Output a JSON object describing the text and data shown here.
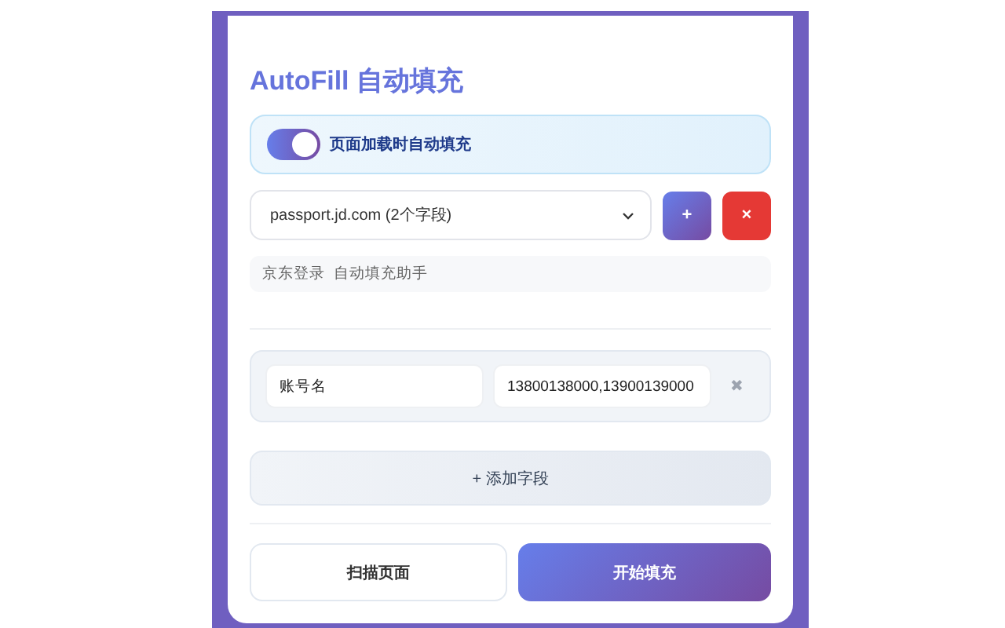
{
  "title": "AutoFill 自动填充",
  "auto_fill_toggle": {
    "label": "页面加载时自动填充",
    "on": true
  },
  "site_select": {
    "value": "passport.jd.com (2个字段)",
    "add_label": "+",
    "delete_label": "×"
  },
  "site_note": "京东登录  自动填充助手",
  "fields": [
    {
      "name": "账号名",
      "value": "13800138000,13900139000",
      "remove_label": "✖"
    }
  ],
  "add_field_label": "+ 添加字段",
  "buttons": [
    {
      "label": "扫描页面",
      "kind": "secondary"
    },
    {
      "label": "开始填充",
      "kind": "primary"
    }
  ]
}
